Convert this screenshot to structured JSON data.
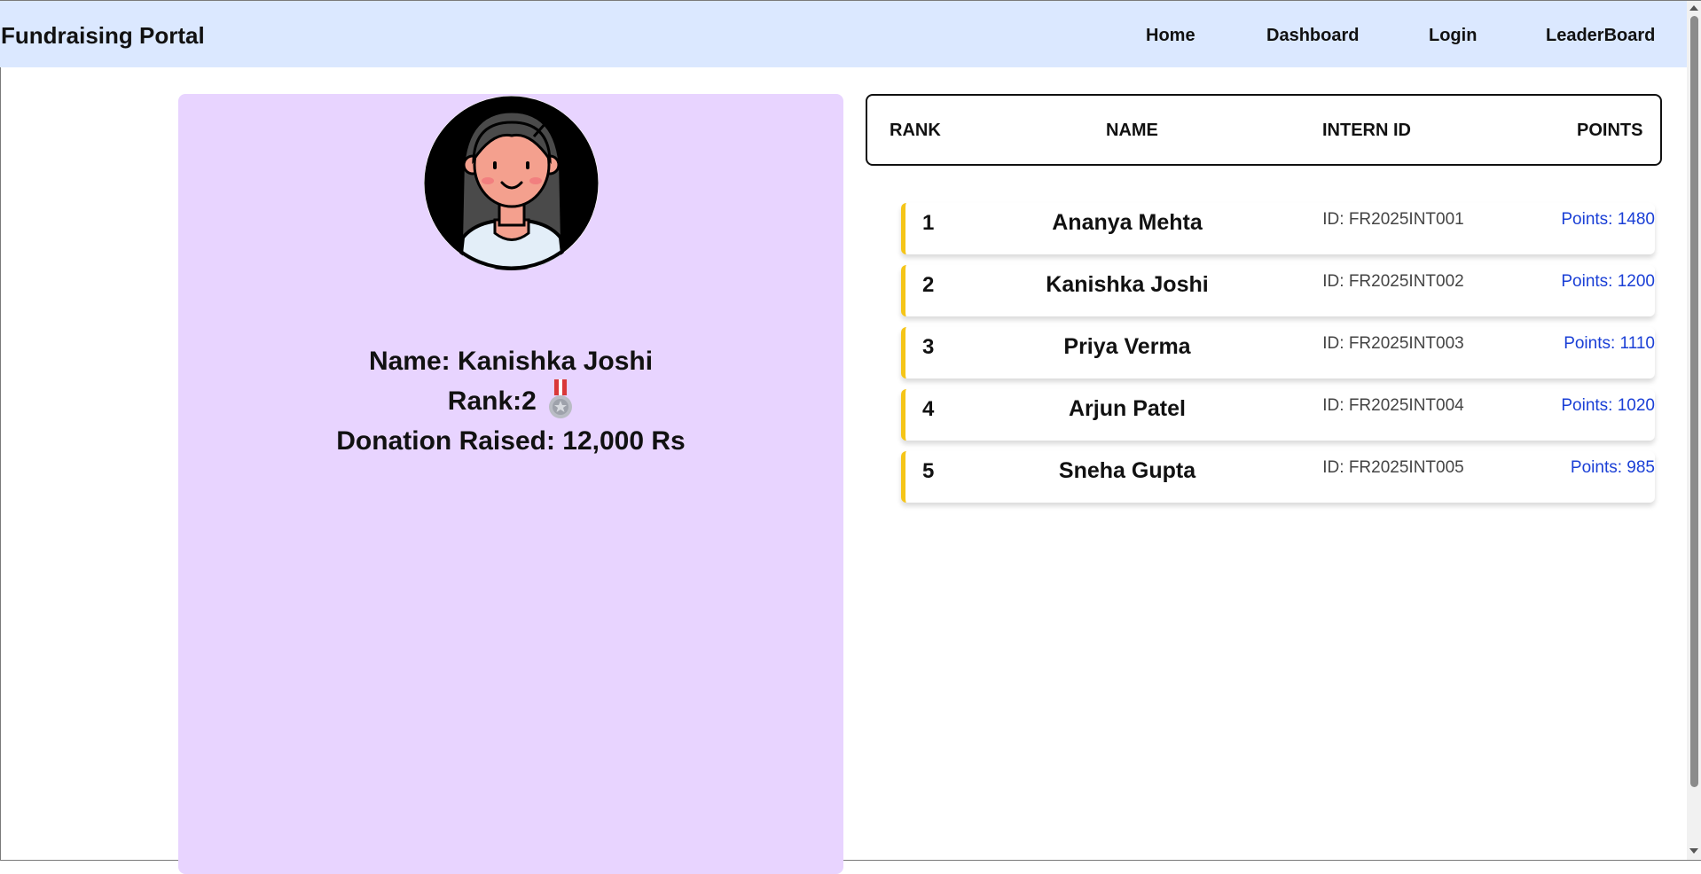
{
  "navbar": {
    "brand": "Fundraising Portal",
    "links": [
      "Home",
      "Dashboard",
      "Login",
      "LeaderBoard"
    ]
  },
  "profile": {
    "name_line": "Name: Kanishka Joshi",
    "rank_line": "Rank:2",
    "donation_line": "Donation Raised: 12,000 Rs",
    "avatar_icon": "girl-avatar-icon",
    "medal_icon": "silver-medal-icon"
  },
  "leaderboard": {
    "headers": [
      "RANK",
      "NAME",
      "INTERN ID",
      "POINTS"
    ],
    "rows": [
      {
        "rank": "1",
        "name": "Ananya Mehta",
        "intern_id": "ID: FR2025INT001",
        "points": "Points: 1480"
      },
      {
        "rank": "2",
        "name": "Kanishka Joshi",
        "intern_id": "ID: FR2025INT002",
        "points": "Points: 1200"
      },
      {
        "rank": "3",
        "name": "Priya Verma",
        "intern_id": "ID: FR2025INT003",
        "points": "Points: 1110"
      },
      {
        "rank": "4",
        "name": "Arjun Patel",
        "intern_id": "ID: FR2025INT004",
        "points": "Points: 1020"
      },
      {
        "rank": "5",
        "name": "Sneha Gupta",
        "intern_id": "ID: FR2025INT005",
        "points": "Points: 985"
      }
    ]
  },
  "colors": {
    "navbar_bg": "#dbe8ff",
    "card_bg": "#e8d4ff",
    "row_accent": "#f5c518",
    "points_text": "#1a3fd6"
  }
}
